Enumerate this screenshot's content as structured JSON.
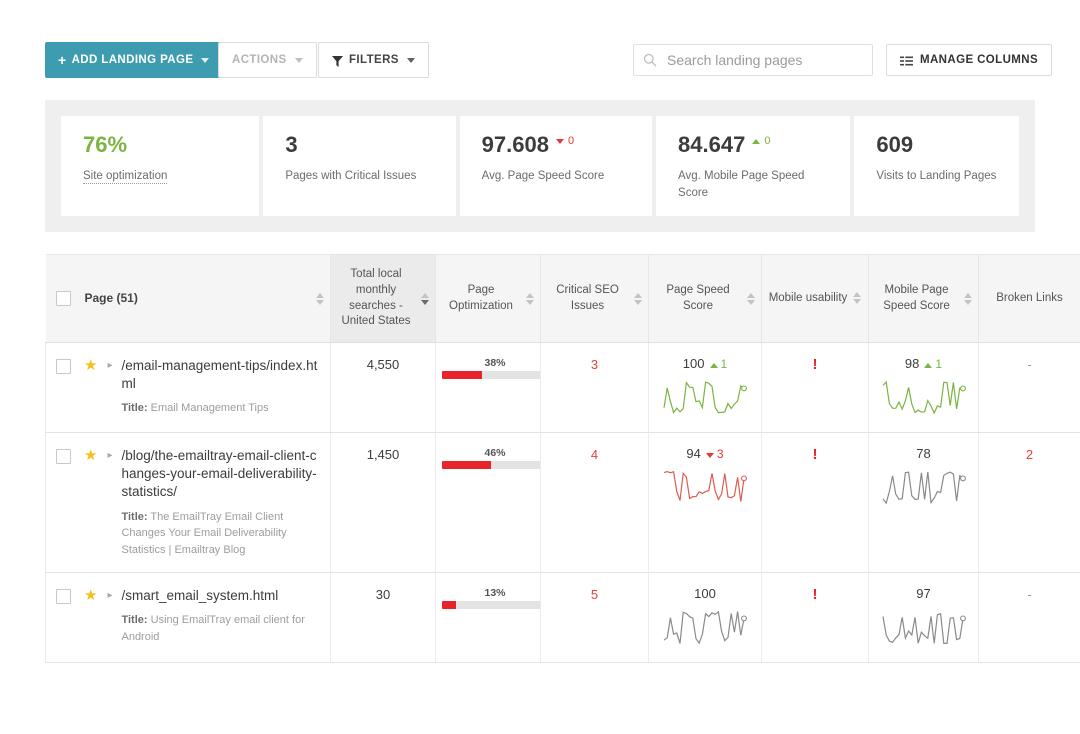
{
  "toolbar": {
    "add_label": "ADD LANDING PAGE",
    "add_plus": "+",
    "actions_label": "ACTIONS",
    "filters_label": "FILTERS",
    "manage_columns_label": "MANAGE COLUMNS",
    "accent_color": "#3e9cb0"
  },
  "search": {
    "placeholder": "Search landing pages",
    "value": ""
  },
  "stats": [
    {
      "value": "76%",
      "label": "Site optimization",
      "value_color": "#7cb342",
      "dotted": true
    },
    {
      "value": "3",
      "label": "Pages with Critical Issues",
      "value_color": "#3c3c3c",
      "dotted": false
    },
    {
      "value": "97.608",
      "label": "Avg. Page Speed Score",
      "value_color": "#3c3c3c",
      "delta": "0",
      "delta_dir": "down",
      "dotted": false
    },
    {
      "value": "84.647",
      "label": "Avg. Mobile Page Speed Score",
      "value_color": "#3c3c3c",
      "delta": "0",
      "delta_dir": "up",
      "dotted": false
    },
    {
      "value": "609",
      "label": "Visits to Landing Pages",
      "value_color": "#3c3c3c",
      "dotted": false
    }
  ],
  "table": {
    "columns": [
      {
        "label": "Page (51)",
        "sortable": true,
        "active": false
      },
      {
        "label": "Total local monthly searches - United States",
        "sortable": true,
        "active": true,
        "sort_dir": "desc"
      },
      {
        "label": "Page Optimization",
        "sortable": true,
        "active": false
      },
      {
        "label": "Critical SEO Issues",
        "sortable": true,
        "active": false
      },
      {
        "label": "Page Speed Score",
        "sortable": true,
        "active": false
      },
      {
        "label": "Mobile usability",
        "sortable": true,
        "active": false
      },
      {
        "label": "Mobile Page Speed Score",
        "sortable": true,
        "active": false
      },
      {
        "label": "Broken Links",
        "sortable": false,
        "active": false
      }
    ],
    "rows": [
      {
        "url": "/email-management-tips/index.html",
        "title_label": "Title:",
        "title": "Email Management Tips",
        "starred": true,
        "searches": "4,550",
        "optimization_pct": "38%",
        "optimization_value": 38,
        "critical_issues": "3",
        "page_speed": "100",
        "page_speed_delta": "1",
        "page_speed_dir": "up",
        "page_speed_color": "#7cb342",
        "mobile_usability": "!",
        "mobile_speed": "98",
        "mobile_speed_delta": "1",
        "mobile_speed_dir": "up",
        "mobile_speed_color": "#7cb342",
        "broken_links": "-"
      },
      {
        "url": "/blog/the-emailtray-email-client-changes-your-email-deliverability-statistics/",
        "title_label": "Title:",
        "title": "The EmailTray Email Client Changes Your Email Deliverability Statistics | Emailtray Blog",
        "starred": true,
        "searches": "1,450",
        "optimization_pct": "46%",
        "optimization_value": 46,
        "critical_issues": "4",
        "page_speed": "94",
        "page_speed_delta": "3",
        "page_speed_dir": "down",
        "page_speed_color": "#e05a52",
        "mobile_usability": "!",
        "mobile_speed": "78",
        "mobile_speed_delta": "",
        "mobile_speed_dir": "none",
        "mobile_speed_color": "#8a8a8a",
        "broken_links": "2"
      },
      {
        "url": "/smart_email_system.html",
        "title_label": "Title:",
        "title": "Using EmailTray email client for Android",
        "starred": true,
        "searches": "30",
        "optimization_pct": "13%",
        "optimization_value": 13,
        "critical_issues": "5",
        "page_speed": "100",
        "page_speed_delta": "",
        "page_speed_dir": "none",
        "page_speed_color": "#8a8a8a",
        "mobile_usability": "!",
        "mobile_speed": "97",
        "mobile_speed_delta": "",
        "mobile_speed_dir": "none",
        "mobile_speed_color": "#8a8a8a",
        "broken_links": "-"
      }
    ]
  }
}
